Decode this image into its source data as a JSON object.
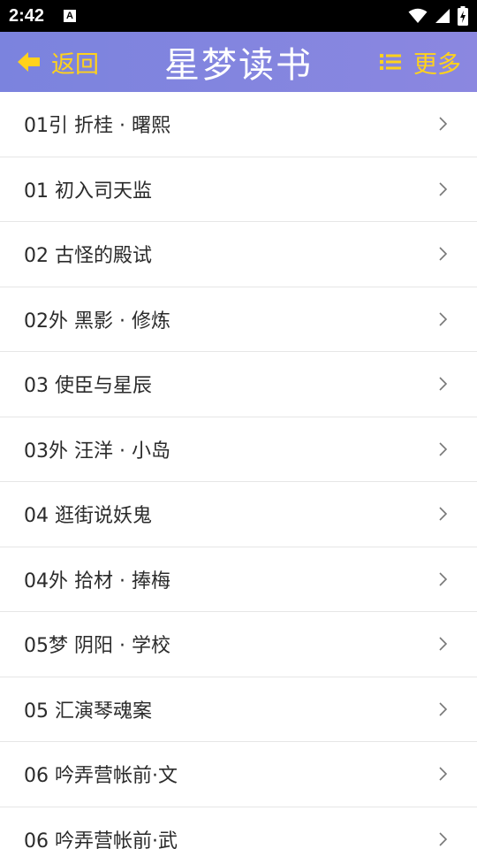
{
  "status_bar": {
    "time": "2:42",
    "notification_icon": "A",
    "icons": [
      "wifi-icon",
      "signal-icon",
      "battery-charging-icon"
    ]
  },
  "header": {
    "back_label": "返回",
    "title": "星梦读书",
    "more_label": "更多",
    "background": "#7f85df",
    "accent_color": "#ffd21c"
  },
  "chapters": [
    {
      "title": "01引 折桂 · 曙熙"
    },
    {
      "title": "01 初入司天监"
    },
    {
      "title": "02 古怪的殿试"
    },
    {
      "title": "02外 黑影 · 修炼"
    },
    {
      "title": "03 使臣与星辰"
    },
    {
      "title": "03外 汪洋 · 小岛"
    },
    {
      "title": "04 逛街说妖鬼"
    },
    {
      "title": "04外 拾材 · 捧梅"
    },
    {
      "title": "05梦 阴阳 · 学校"
    },
    {
      "title": "05 汇演琴魂案"
    },
    {
      "title": "06 吟弄营帐前·文"
    },
    {
      "title": "06 吟弄营帐前·武"
    }
  ]
}
